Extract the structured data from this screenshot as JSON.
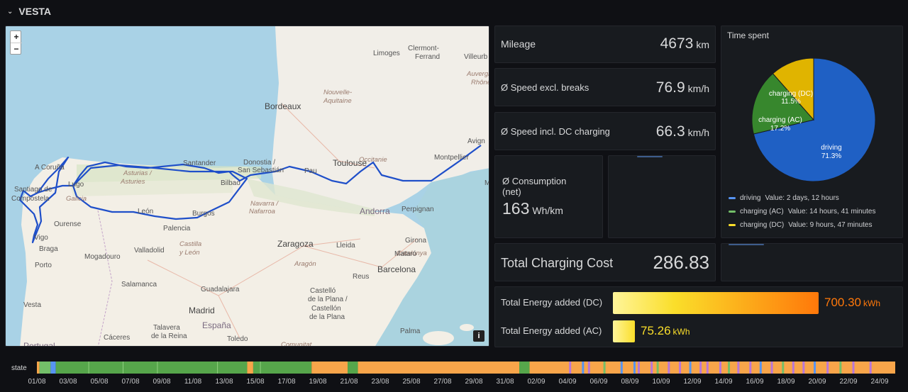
{
  "row": {
    "title": "VESTA"
  },
  "map": {
    "zoom_in": "+",
    "zoom_out": "−",
    "info": "i",
    "labels": [
      {
        "text": "Limoges",
        "cls": "ml"
      },
      {
        "text": "Clermont-",
        "cls": "ml"
      },
      {
        "text": "Ferrand",
        "cls": "ml"
      },
      {
        "text": "Villeurb",
        "cls": "ml"
      },
      {
        "text": "Auvergne-",
        "cls": "ml reg"
      },
      {
        "text": "Rhône-A",
        "cls": "ml reg"
      },
      {
        "text": "Bordeaux",
        "cls": "ml big"
      },
      {
        "text": "Nouvelle-",
        "cls": "ml reg"
      },
      {
        "text": "Aquitaine",
        "cls": "ml reg"
      },
      {
        "text": "Toulouse",
        "cls": "ml big"
      },
      {
        "text": "Occitanie",
        "cls": "ml reg"
      },
      {
        "text": "Montpellier",
        "cls": "ml"
      },
      {
        "text": "Avign",
        "cls": "ml"
      },
      {
        "text": "M",
        "cls": "ml"
      },
      {
        "text": "A Coruña",
        "cls": "ml"
      },
      {
        "text": "Santander",
        "cls": "ml"
      },
      {
        "text": "Donostia /",
        "cls": "ml"
      },
      {
        "text": "San Sebastián",
        "cls": "ml"
      },
      {
        "text": "Pau",
        "cls": "ml"
      },
      {
        "text": "Asturias /",
        "cls": "ml reg"
      },
      {
        "text": "Asturies",
        "cls": "ml reg"
      },
      {
        "text": "Bilbao",
        "cls": "ml"
      },
      {
        "text": "Lugo",
        "cls": "ml"
      },
      {
        "text": "Santiago de",
        "cls": "ml"
      },
      {
        "text": "Compostela",
        "cls": "ml"
      },
      {
        "text": "Galicia",
        "cls": "ml reg"
      },
      {
        "text": "Ourense",
        "cls": "ml"
      },
      {
        "text": "Vigo",
        "cls": "ml"
      },
      {
        "text": "León",
        "cls": "ml"
      },
      {
        "text": "Burgos",
        "cls": "ml"
      },
      {
        "text": "Navarra /",
        "cls": "ml reg"
      },
      {
        "text": "Nafarroa",
        "cls": "ml reg"
      },
      {
        "text": "Andorra",
        "cls": "ml ctry"
      },
      {
        "text": "Perpignan",
        "cls": "ml"
      },
      {
        "text": "Palencia",
        "cls": "ml"
      },
      {
        "text": "Zaragoza",
        "cls": "ml big"
      },
      {
        "text": "Lleida",
        "cls": "ml"
      },
      {
        "text": "Girona",
        "cls": "ml"
      },
      {
        "text": "Catalunya",
        "cls": "ml reg"
      },
      {
        "text": "Mataró",
        "cls": "ml"
      },
      {
        "text": "Braga",
        "cls": "ml"
      },
      {
        "text": "Mogadouro",
        "cls": "ml"
      },
      {
        "text": "Valladolid",
        "cls": "ml"
      },
      {
        "text": "Castilla",
        "cls": "ml reg"
      },
      {
        "text": "y León",
        "cls": "ml reg"
      },
      {
        "text": "Aragón",
        "cls": "ml reg"
      },
      {
        "text": "Reus",
        "cls": "ml"
      },
      {
        "text": "Barcelona",
        "cls": "ml big"
      },
      {
        "text": "Porto",
        "cls": "ml"
      },
      {
        "text": "Salamanca",
        "cls": "ml"
      },
      {
        "text": "Guadalajara",
        "cls": "ml"
      },
      {
        "text": "Castelló",
        "cls": "ml"
      },
      {
        "text": "de la Plana /",
        "cls": "ml"
      },
      {
        "text": "Castellón",
        "cls": "ml"
      },
      {
        "text": "de la Plana",
        "cls": "ml"
      },
      {
        "text": "Vesta",
        "cls": "ml"
      },
      {
        "text": "Madrid",
        "cls": "ml big"
      },
      {
        "text": "Talavera",
        "cls": "ml"
      },
      {
        "text": "de la Reina",
        "cls": "ml"
      },
      {
        "text": "España",
        "cls": "ml ctry"
      },
      {
        "text": "Palma",
        "cls": "ml"
      },
      {
        "text": "Cáceres",
        "cls": "ml"
      },
      {
        "text": "Toledo",
        "cls": "ml"
      },
      {
        "text": "Portugal",
        "cls": "ml ctry"
      },
      {
        "text": "Comunitat",
        "cls": "ml reg"
      }
    ]
  },
  "stats": {
    "mileage": {
      "title": "Mileage",
      "value": "4673",
      "unit": "km"
    },
    "speed_excl": {
      "title": "Ø Speed excl. breaks",
      "value": "76.9",
      "unit": "km/h"
    },
    "speed_incl": {
      "title": "Ø Speed incl. DC charging",
      "value": "66.3",
      "unit": "km/h"
    },
    "consumption": {
      "title_1": "Ø Consumption",
      "title_2": "(net)",
      "value": "163",
      "unit": "Wh/km"
    },
    "cost": {
      "title": "Total Charging Cost",
      "value": "286.83"
    }
  },
  "time_spent": {
    "title": "Time spent",
    "slices": [
      {
        "name": "driving",
        "percent": 71.3,
        "label": "71.3%",
        "color": "#1f60c4",
        "value_text": "Value: 2 days, 12 hours"
      },
      {
        "name": "charging (AC)",
        "percent": 17.2,
        "label": "17.2%",
        "color": "#37872d",
        "value_text": "Value: 14 hours, 41 minutes"
      },
      {
        "name": "charging (DC)",
        "percent": 11.5,
        "label": "11.5%",
        "color": "#e0b400",
        "value_text": "Value: 9 hours, 47 minutes"
      }
    ],
    "legend_colors": [
      "#5794f2",
      "#73bf69",
      "#fade2a"
    ]
  },
  "energy": {
    "dc": {
      "label": "Total Energy added (DC)",
      "value": "700.30",
      "unit": "kWh",
      "fraction": 1.0,
      "color": "#ff780a"
    },
    "ac": {
      "label": "Total Energy added (AC)",
      "value": "75.26",
      "unit": "kWh",
      "fraction": 0.107,
      "color": "#fade2a"
    }
  },
  "timeline": {
    "label": "state",
    "ticks": [
      "01/08",
      "03/08",
      "05/08",
      "07/08",
      "09/08",
      "11/08",
      "13/08",
      "15/08",
      "17/08",
      "19/08",
      "21/08",
      "23/08",
      "25/08",
      "27/08",
      "29/08",
      "31/08",
      "02/09",
      "04/09",
      "06/09",
      "08/09",
      "10/09",
      "12/09",
      "14/09",
      "16/09",
      "18/09",
      "20/09",
      "22/09",
      "24/09"
    ],
    "colors": {
      "offline": "#56a64b",
      "asleep": "#f8a54a",
      "charging": "#b877d9",
      "driving": "#5794f2",
      "online": "#73bf69"
    }
  }
}
